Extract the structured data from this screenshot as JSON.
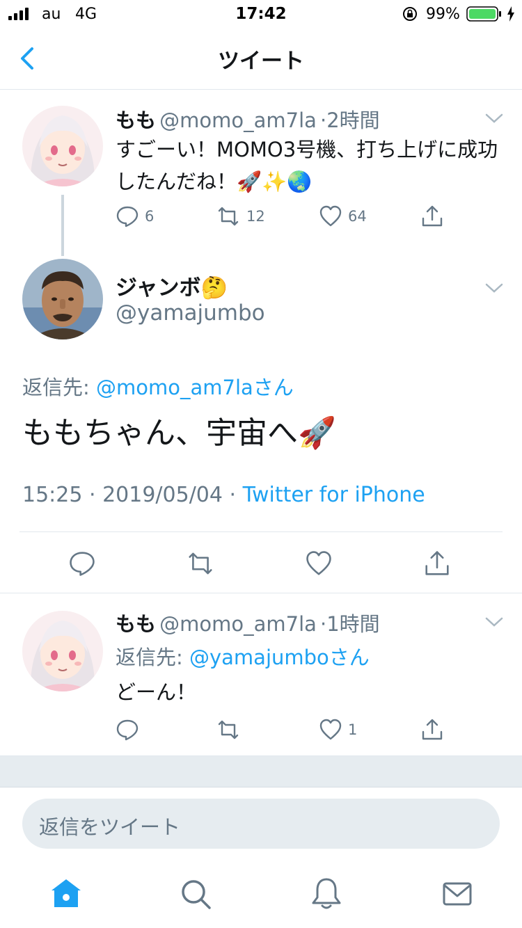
{
  "status_bar": {
    "carrier": "au",
    "network": "4G",
    "time": "17:42",
    "battery": "99%"
  },
  "header": {
    "title": "ツイート"
  },
  "tweet1": {
    "name": "もも",
    "handle": "@momo_am7la",
    "time": "·2時間",
    "text": "すごーい！MOMO3号機、打ち上げに成功したんだね！🚀✨🌏",
    "replies": "6",
    "retweets": "12",
    "likes": "64"
  },
  "main_tweet": {
    "name": "ジャンボ🤔",
    "handle": "@yamajumbo",
    "reply_prefix": "返信先: ",
    "reply_to": "@momo_am7laさん",
    "text": "ももちゃん、宇宙へ🚀",
    "date": "15:25 · 2019/05/04 · ",
    "source": "Twitter for iPhone"
  },
  "tweet2": {
    "name": "もも",
    "handle": "@momo_am7la",
    "time": "·1時間",
    "reply_prefix": "返信先: ",
    "reply_to": "@yamajumboさん",
    "text": "どーん！",
    "likes": "1"
  },
  "composer": {
    "placeholder": "返信をツイート"
  },
  "colors": {
    "accent": "#1da1f2",
    "muted": "#657786",
    "battery": "#4cd964"
  }
}
